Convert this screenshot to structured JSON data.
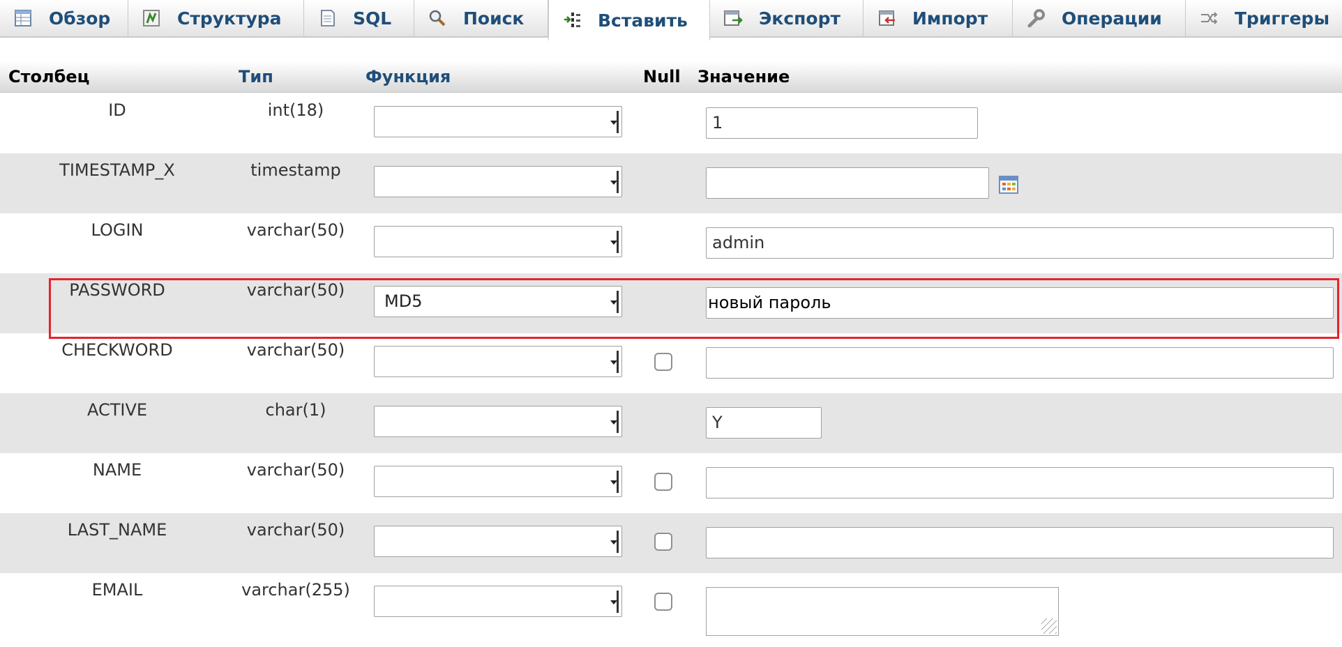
{
  "tabs": [
    {
      "label": "Обзор",
      "icon": "browse-table-icon"
    },
    {
      "label": "Структура",
      "icon": "structure-icon"
    },
    {
      "label": "SQL",
      "icon": "sql-document-icon"
    },
    {
      "label": "Поиск",
      "icon": "magnifier-icon"
    },
    {
      "label": "Вставить",
      "icon": "insert-row-icon",
      "active": true
    },
    {
      "label": "Экспорт",
      "icon": "export-icon"
    },
    {
      "label": "Импорт",
      "icon": "import-icon"
    },
    {
      "label": "Операции",
      "icon": "wrench-icon"
    },
    {
      "label": "Триггеры",
      "icon": "triggers-icon"
    }
  ],
  "table": {
    "headers": {
      "column": "Столбец",
      "type": "Тип",
      "function": "Функция",
      "null": "Null",
      "value": "Значение"
    },
    "rows": [
      {
        "name": "ID",
        "type": "int(18)",
        "function": "",
        "null_checkbox": false,
        "value": "1"
      },
      {
        "name": "TIMESTAMP_X",
        "type": "timestamp",
        "function": "",
        "null_checkbox": false,
        "value": "",
        "calendar": true
      },
      {
        "name": "LOGIN",
        "type": "varchar(50)",
        "function": "",
        "null_checkbox": false,
        "value": "admin"
      },
      {
        "name": "PASSWORD",
        "type": "varchar(50)",
        "function": "MD5",
        "null_checkbox": false,
        "value": "новый пароль",
        "highlighted": true
      },
      {
        "name": "CHECKWORD",
        "type": "varchar(50)",
        "function": "",
        "null_checkbox": true,
        "value": ""
      },
      {
        "name": "ACTIVE",
        "type": "char(1)",
        "function": "",
        "null_checkbox": false,
        "value": "Y"
      },
      {
        "name": "NAME",
        "type": "varchar(50)",
        "function": "",
        "null_checkbox": true,
        "value": ""
      },
      {
        "name": "LAST_NAME",
        "type": "varchar(50)",
        "function": "",
        "null_checkbox": true,
        "value": ""
      },
      {
        "name": "EMAIL",
        "type": "varchar(255)",
        "function": "",
        "null_checkbox": true,
        "value": "",
        "textarea": true
      }
    ]
  },
  "colors": {
    "link": "#1f4e79",
    "row_alt": "#e5e5e5",
    "highlight_border": "#e3242b"
  }
}
